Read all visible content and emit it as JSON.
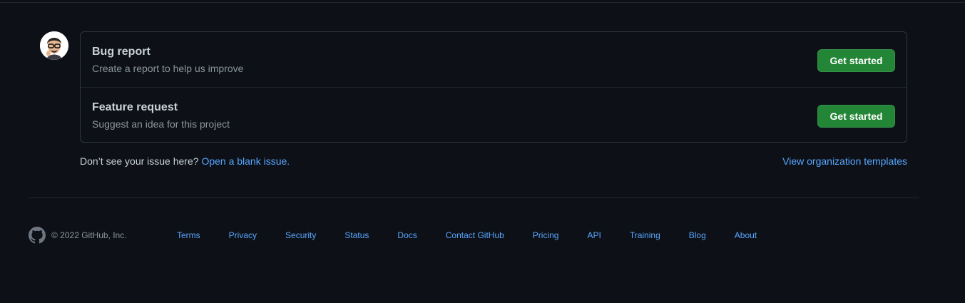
{
  "templates": [
    {
      "title": "Bug report",
      "description": "Create a report to help us improve",
      "button": "Get started"
    },
    {
      "title": "Feature request",
      "description": "Suggest an idea for this project",
      "button": "Get started"
    }
  ],
  "blank_issue": {
    "prompt": "Don’t see your issue here?",
    "link": "Open a blank issue."
  },
  "org_templates_link": "View organization templates",
  "footer": {
    "copyright": "© 2022 GitHub, Inc.",
    "links": [
      "Terms",
      "Privacy",
      "Security",
      "Status",
      "Docs",
      "Contact GitHub",
      "Pricing",
      "API",
      "Training",
      "Blog",
      "About"
    ]
  },
  "colors": {
    "background": "#0d1117",
    "accent_link": "#58a6ff",
    "button_green": "#238636",
    "border": "#30363d"
  },
  "icons": {
    "avatar": "user-avatar",
    "footer_logo": "github-mark-icon"
  }
}
